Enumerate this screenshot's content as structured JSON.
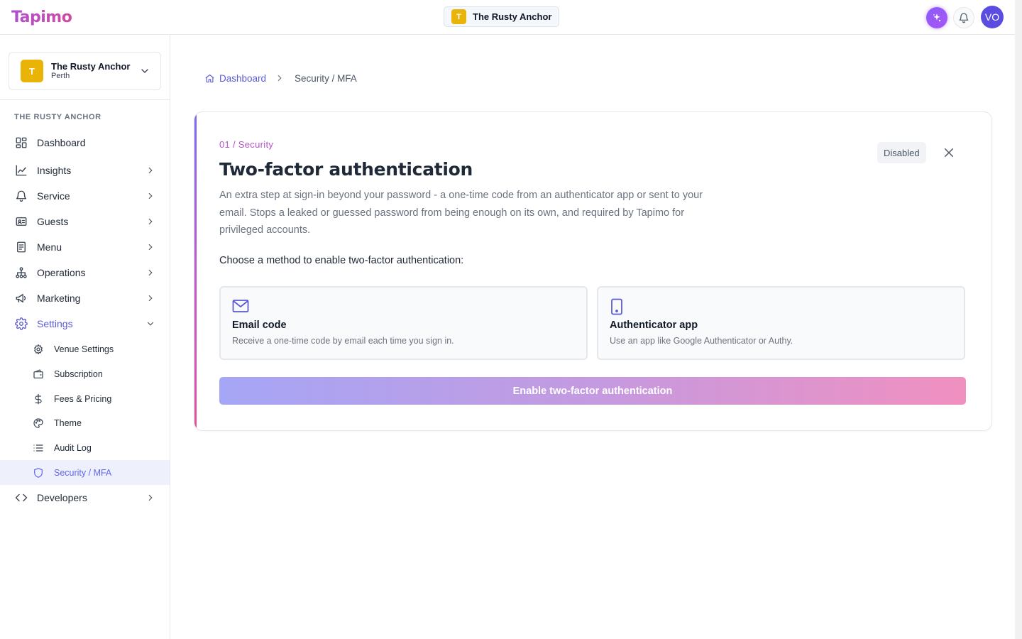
{
  "app": {
    "logo_text": "Tapimo"
  },
  "topbar": {
    "venue": {
      "initial": "T",
      "name": "The Rusty Anchor"
    },
    "avatar_initials": "VO",
    "icons": {
      "ai": "sparkles-icon",
      "notifications": "bell-icon"
    }
  },
  "sidebar": {
    "venue_card": {
      "initial": "T",
      "name": "The Rusty Anchor",
      "city": "Perth"
    },
    "section_label": "THE RUSTY ANCHOR",
    "items": [
      {
        "label": "Dashboard",
        "icon": "dashboard-icon"
      },
      {
        "label": "Insights",
        "icon": "chart-line-icon"
      },
      {
        "label": "Service",
        "icon": "bell-icon"
      },
      {
        "label": "Guests",
        "icon": "id-card-icon"
      },
      {
        "label": "Menu",
        "icon": "document-icon"
      },
      {
        "label": "Operations",
        "icon": "sitemap-icon"
      },
      {
        "label": "Marketing",
        "icon": "megaphone-icon"
      },
      {
        "label": "Settings",
        "icon": "gear-icon",
        "expanded": true
      },
      {
        "label": "Developers",
        "icon": "code-icon"
      }
    ],
    "settings_subitems": [
      {
        "label": "Venue Settings",
        "icon": "gear-icon"
      },
      {
        "label": "Subscription",
        "icon": "wallet-icon"
      },
      {
        "label": "Fees & Pricing",
        "icon": "dollar-icon"
      },
      {
        "label": "Theme",
        "icon": "palette-icon"
      },
      {
        "label": "Audit Log",
        "icon": "list-icon"
      },
      {
        "label": "Security / MFA",
        "icon": "shield-icon",
        "current": true
      }
    ]
  },
  "breadcrumb": {
    "home": "Dashboard",
    "current": "Security / MFA"
  },
  "card": {
    "eyebrow": "01 / Security",
    "title": "Two-factor authentication",
    "description": "An extra step at sign-in beyond your password - a one-time code from an authenticator app or sent to your email. Stops a leaked or guessed password from being enough on its own, and required by Tapimo for privileged accounts.",
    "status": "Disabled",
    "choose_label": "Choose a method to enable two-factor authentication:",
    "methods": [
      {
        "title": "Email code",
        "description": "Receive a one-time code by email each time you sign in.",
        "icon": "envelope-icon"
      },
      {
        "title": "Authenticator app",
        "description": "Use an app like Google Authenticator or Authy.",
        "icon": "phone-icon"
      }
    ],
    "enable_button": "Enable two-factor authentication"
  },
  "colors": {
    "accent": "#5b5bd6",
    "brand_gradient_start": "#b14fd0",
    "brand_gradient_end": "#e0559e",
    "venue_icon": "#eab308",
    "avatar": "#5b4de0"
  }
}
